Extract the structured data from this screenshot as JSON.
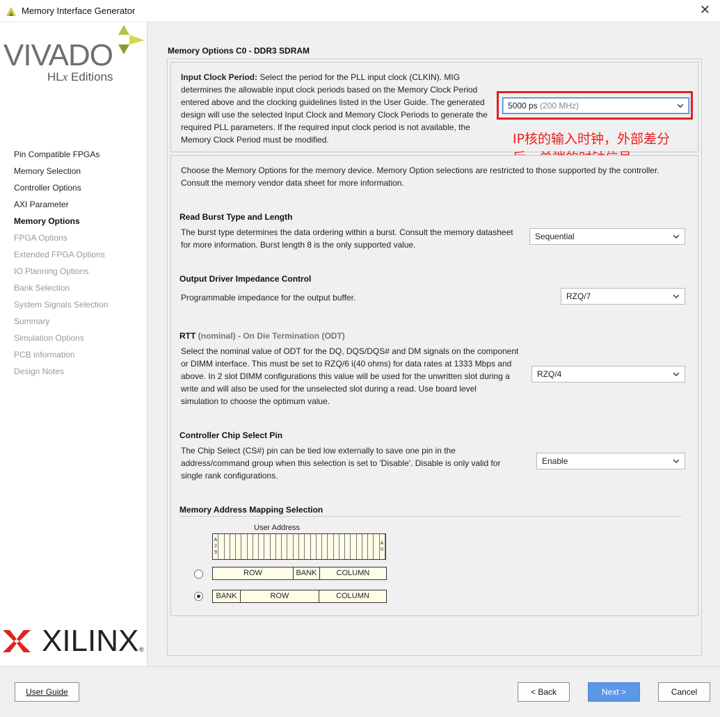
{
  "window": {
    "title": "Memory Interface Generator",
    "close_glyph": "✕"
  },
  "branding": {
    "vivado": "VIVADO",
    "hlx_prefix": "HL",
    "hlx_x": "x",
    "hlx_suffix": " Editions",
    "xilinx": "XILINX",
    "registered": "®"
  },
  "nav": {
    "items": [
      {
        "label": "Pin Compatible FPGAs",
        "state": "normal"
      },
      {
        "label": "Memory Selection",
        "state": "normal"
      },
      {
        "label": "Controller Options",
        "state": "normal"
      },
      {
        "label": "AXI Parameter",
        "state": "normal"
      },
      {
        "label": "Memory Options",
        "state": "active"
      },
      {
        "label": "FPGA Options",
        "state": "disabled"
      },
      {
        "label": "Extended FPGA Options",
        "state": "disabled"
      },
      {
        "label": "IO Planning Options",
        "state": "disabled"
      },
      {
        "label": "Bank Selection",
        "state": "disabled"
      },
      {
        "label": "System Signals Selection",
        "state": "disabled"
      },
      {
        "label": "Summary",
        "state": "disabled"
      },
      {
        "label": "Simulation Options",
        "state": "disabled"
      },
      {
        "label": "PCB information",
        "state": "disabled"
      },
      {
        "label": "Design Notes",
        "state": "disabled"
      }
    ]
  },
  "main": {
    "title": "Memory Options C0 - DDR3 SDRAM",
    "input_clock": {
      "label_bold": "Input Clock Period:",
      "lines": [
        " Select the period for the PLL input clock (CLKIN). MIG",
        "determines the allowable input clock periods based on the Memory Clock Period",
        "entered above and the clocking guidelines listed in the User Guide. The generated",
        "design will use the selected Input Clock and Memory Clock Periods to generate the",
        "required PLL parameters. If the required input clock period is not available, the",
        "Memory Clock Period must be modified."
      ],
      "value": "5000 ps",
      "value_hint": "(200 MHz)"
    },
    "annotation": "IP核的输入时钟，外部差分后，单端的时钟信号",
    "intro_lines": [
      "Choose the Memory Options for the memory device. Memory Option selections are restricted to those supported by the controller.",
      "Consult the memory vendor data sheet for more information."
    ],
    "burst": {
      "title": "Read Burst Type and Length",
      "lines": [
        "The burst type determines the data ordering within a burst. Consult the memory datasheet",
        "for more information. Burst length 8 is the only supported value."
      ],
      "value": "Sequential"
    },
    "odic": {
      "title": "Output Driver Impedance Control",
      "lines": [
        "Programmable impedance for the output buffer."
      ],
      "value": "RZQ/7"
    },
    "rtt": {
      "title_a": "RTT",
      "title_b": " (nominal)",
      "title_c": " - On Die Termination (ODT)",
      "lines": [
        "Select the nominal value of ODT for the DQ, DQS/DQS# and DM signals on the component",
        "or DIMM interface. This must be set to RZQ/6 i(40 ohms) for data rates at 1333 Mbps and",
        "above. In 2 slot DIMM configurations this value will be used for the unwritten slot during a",
        "write and will also be used for the unselected slot during a read. Use board level",
        "simulation to choose the optimum value."
      ],
      "value": "RZQ/4"
    },
    "cs": {
      "title": "Controller Chip Select Pin",
      "lines": [
        "The Chip Select (CS#) pin can be tied low externally to save one pin in the",
        "address/command group when this selection is set to 'Disable'. Disable is only valid for",
        "single rank configurations."
      ],
      "value": "Enable"
    },
    "mapping": {
      "title": "Memory Address Mapping Selection",
      "user_address": "User Address",
      "msb_bits": [
        "A",
        "2",
        "9"
      ],
      "lsb_bits": [
        "A",
        "0"
      ],
      "option1": {
        "seg1": "ROW",
        "seg2": "BANK",
        "seg3": "COLUMN",
        "selected": false
      },
      "option2": {
        "seg1": "BANK",
        "seg2": "ROW",
        "seg3": "COLUMN",
        "selected": true
      }
    }
  },
  "footer": {
    "user_guide": "User Guide",
    "back": "< Back",
    "next": "Next >",
    "cancel": "Cancel"
  }
}
